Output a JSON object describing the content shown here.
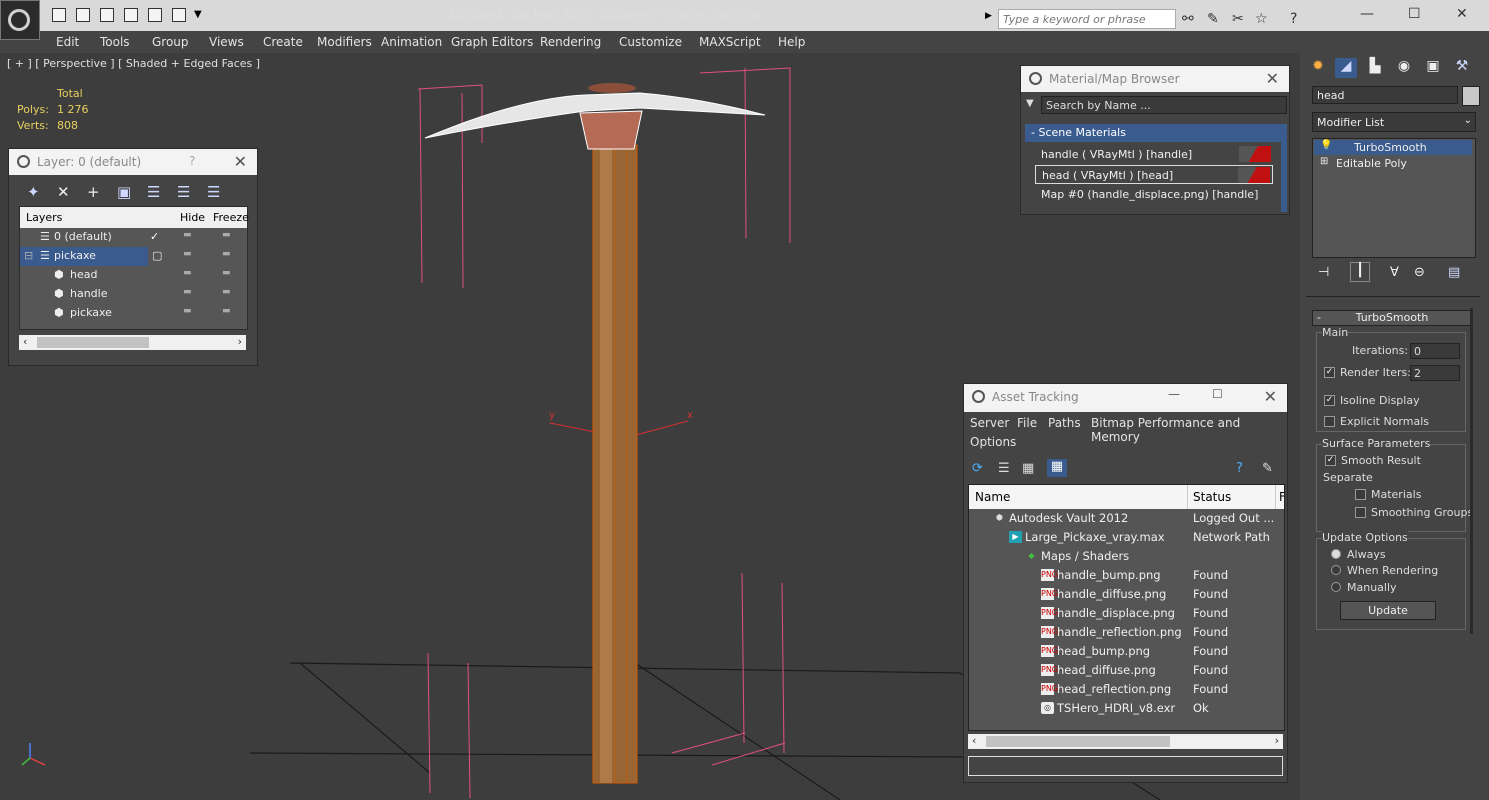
{
  "app": {
    "title": "Autodesk 3ds Max  2012 x64",
    "file": "Large_Pickaxe_vray.max",
    "search_placeholder": "Type a keyword or phrase"
  },
  "menu": [
    "Edit",
    "Tools",
    "Group",
    "Views",
    "Create",
    "Modifiers",
    "Animation",
    "Graph Editors",
    "Rendering",
    "Customize",
    "MAXScript",
    "Help"
  ],
  "viewport": {
    "label": "[ + ] [ Perspective ] [ Shaded + Edged Faces ]",
    "stats": {
      "total": "Total",
      "polys_label": "Polys:",
      "polys": "1 276",
      "verts_label": "Verts:",
      "verts": "808"
    },
    "gizmo_x": "x",
    "gizmo_y": "y"
  },
  "layer_panel": {
    "title": "Layer: 0 (default)",
    "help": "?",
    "columns": [
      "Layers",
      "Hide",
      "Freeze"
    ],
    "rows": [
      {
        "name": "0 (default)"
      },
      {
        "name": "pickaxe"
      },
      {
        "name": "head"
      },
      {
        "name": "handle"
      },
      {
        "name": "pickaxe"
      }
    ]
  },
  "material_browser": {
    "title": "Material/Map Browser",
    "search_placeholder": "Search by Name ...",
    "section": "Scene Materials",
    "items": [
      "handle  ( VRayMtl )  [handle]",
      "head  ( VRayMtl )  [head]",
      "Map #0 (handle_displace.png)  [handle]"
    ]
  },
  "asset_tracking": {
    "title": "Asset Tracking",
    "menu": [
      "Server",
      "File",
      "Paths",
      "Bitmap Performance and Memory",
      "Options"
    ],
    "columns": [
      "Name",
      "Status",
      "F"
    ],
    "rows": [
      {
        "name": "Autodesk Vault 2012",
        "status": "Logged Out ..."
      },
      {
        "name": "Large_Pickaxe_vray.max",
        "status": "Network Path"
      },
      {
        "name": "Maps / Shaders",
        "status": ""
      },
      {
        "name": "handle_bump.png",
        "status": "Found"
      },
      {
        "name": "handle_diffuse.png",
        "status": "Found"
      },
      {
        "name": "handle_displace.png",
        "status": "Found"
      },
      {
        "name": "handle_reflection.png",
        "status": "Found"
      },
      {
        "name": "head_bump.png",
        "status": "Found"
      },
      {
        "name": "head_diffuse.png",
        "status": "Found"
      },
      {
        "name": "head_reflection.png",
        "status": "Found"
      },
      {
        "name": "TSHero_HDRI_v8.exr",
        "status": "Ok"
      }
    ]
  },
  "command_panel": {
    "object_name": "head",
    "modifier_list": "Modifier List",
    "stack": [
      "TurboSmooth",
      "Editable Poly"
    ],
    "turbosmooth": {
      "title": "TurboSmooth",
      "main": "Main",
      "iterations_label": "Iterations:",
      "iterations": "0",
      "render_iters_label": "Render Iters:",
      "render_iters": "2",
      "isoline": "Isoline Display",
      "explicit_normals": "Explicit Normals",
      "surface_params": "Surface Parameters",
      "smooth_result": "Smooth Result",
      "separate": "Separate",
      "materials": "Materials",
      "smoothing_groups": "Smoothing Groups",
      "update_options": "Update Options",
      "always": "Always",
      "when_rendering": "When Rendering",
      "manually": "Manually",
      "update": "Update"
    }
  },
  "colors": {
    "selection": "#3a5b8e",
    "bbox": "#e0507a",
    "wire": "#d25a00"
  }
}
